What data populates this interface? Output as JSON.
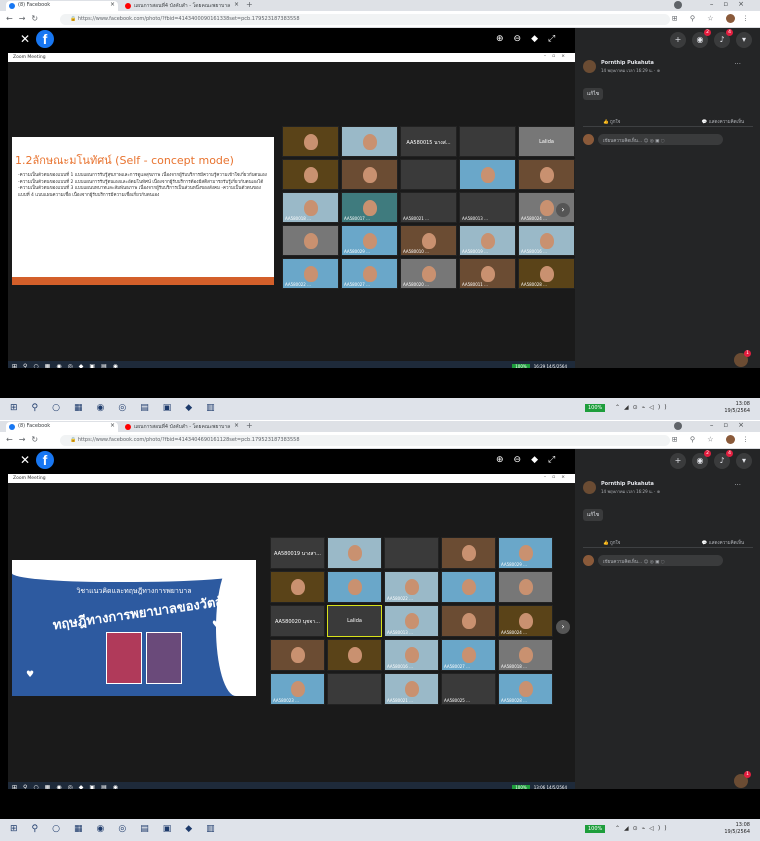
{
  "screens": [
    {
      "tabs": [
        {
          "label": "(8) Facebook"
        },
        {
          "label": "แผนการสอนที่4 บังคับสำ - โดยคณะพยาบาล"
        }
      ],
      "url": "https://www.facebook.com/photo/?fbid=4143400090161338set=pcb.179523187383558",
      "zoom_title": "Zoom Meeting",
      "slide": {
        "title": "1.2ลักษณะมโนทัศน์ (Self - concept mode)",
        "body": "-ความเป็นตัวตนของแบบที่ 1 แบบแผนการรับรู้สุขภาพและการดูแลสุขภาพ เนื่องจากผู้รับบริการมีความรู้ความเข้าใจเกี่ยวกับตนเอง -ความเป็นตัวตนของแบบที่ 2 แบบแผนการรับรู้ตนเองและอัตมโนทัศน์ เนื่องจากผู้รับบริการต้องมีสติสามารถรับรู้เกี่ยวกับตนเองได้ -ความเป็นตัวตนของแบบที่ 3 แบบแผนบทบาทและสัมพันธภาพ เนื่องจากผู้รับบริการเป็นส่วนหนึ่งของสังคม -ความเป็นตัวตนของแบบที่ 4 แบบแผนความเชื่อ เนื่องจากผู้รับบริการมีความเชื่อเกี่ยวกับตนเอง"
      },
      "tiles": [
        {
          "label": "",
          "name": ""
        },
        {
          "label": "",
          "name": ""
        },
        {
          "label": "AA580015 นางส่...",
          "name": "AA580015 นางส่..."
        },
        {
          "label": "",
          "name": ""
        },
        {
          "label": "Lalida",
          "name": "Lalida"
        },
        {
          "label": "",
          "name": ""
        },
        {
          "label": "",
          "name": ""
        },
        {
          "label": "",
          "name": ""
        },
        {
          "label": "",
          "name": ""
        },
        {
          "label": "",
          "name": ""
        },
        {
          "label": "AA580018 ...",
          "name": ""
        },
        {
          "label": "AA580017 ...",
          "name": ""
        },
        {
          "label": "AA580021 ...",
          "name": ""
        },
        {
          "label": "AA580013 ...",
          "name": ""
        },
        {
          "label": "AA580024 ...",
          "name": ""
        },
        {
          "label": "",
          "name": ""
        },
        {
          "label": "AA580029 ...",
          "name": ""
        },
        {
          "label": "AA580010 ...",
          "name": ""
        },
        {
          "label": "AA580019 ...",
          "name": ""
        },
        {
          "label": "AA580016 ...",
          "name": ""
        },
        {
          "label": "AA580022 ...",
          "name": ""
        },
        {
          "label": "AA580027 ...",
          "name": ""
        },
        {
          "label": "AA580020 ...",
          "name": ""
        },
        {
          "label": "AA580011 ...",
          "name": ""
        },
        {
          "label": "AA580028 ...",
          "name": ""
        }
      ],
      "inner_clock": "16:29 14/5/2564",
      "outer_clock": {
        "time": "13:08",
        "date": "19/5/2564"
      },
      "battery": "100%"
    },
    {
      "tabs": [
        {
          "label": "(8) Facebook"
        },
        {
          "label": "แผนการสอนที่4 บังคับสำ - โดยคณะพยาบาล"
        }
      ],
      "url": "https://www.facebook.com/photo/?fbid=4143404690161128set=pcb.179523187383558",
      "zoom_title": "Zoom Meeting",
      "slide": {
        "subtitle": "วิชาแนวคิดและทฤษฎีทางการพยาบาล",
        "title": "ทฤษฎีทางการพยาบาลของวัตสัน"
      },
      "tiles": [
        {
          "label": "AA580019 นางสา...",
          "name": "AA580019 นางสา..."
        },
        {
          "label": "",
          "name": ""
        },
        {
          "label": "",
          "name": ""
        },
        {
          "label": "",
          "name": ""
        },
        {
          "label": "AA580029 ...",
          "name": ""
        },
        {
          "label": "",
          "name": ""
        },
        {
          "label": "",
          "name": ""
        },
        {
          "label": "AA580022 ...",
          "name": ""
        },
        {
          "label": "",
          "name": ""
        },
        {
          "label": "",
          "name": ""
        },
        {
          "label": "AA580020 นุชจา...",
          "name": "AA580020 นุชจา..."
        },
        {
          "label": "Lalida",
          "name": "Lalida"
        },
        {
          "label": "AA580013 ...",
          "name": ""
        },
        {
          "label": "",
          "name": ""
        },
        {
          "label": "AA580024 ...",
          "name": ""
        },
        {
          "label": "",
          "name": ""
        },
        {
          "label": "",
          "name": ""
        },
        {
          "label": "AA580016 ...",
          "name": ""
        },
        {
          "label": "AA580027 ...",
          "name": ""
        },
        {
          "label": "AA580018 ...",
          "name": ""
        },
        {
          "label": "AA580023 ...",
          "name": ""
        },
        {
          "label": "",
          "name": ""
        },
        {
          "label": "AA580021 ...",
          "name": ""
        },
        {
          "label": "AA580025 ...",
          "name": ""
        },
        {
          "label": "AA580028 ...",
          "name": ""
        }
      ],
      "inner_clock": "13:06 14/5/2564",
      "outer_clock": {
        "time": "13:08",
        "date": "19/5/2564"
      },
      "battery": "100%"
    }
  ],
  "post": {
    "author": "Pornthip Pukahuta",
    "time": "14 พฤษภาคม เวลา 16:29 น. · ",
    "button": "แก้ไข",
    "like": "ถูกใจ",
    "comment": "แสดงความคิดเห็น",
    "comment_placeholder": "เขียนความคิดเห็น..."
  },
  "badges": {
    "messenger": "2",
    "notifications": "4",
    "chat": "1"
  },
  "colors": {
    "facebook_blue": "#1877f2",
    "slide_orange": "#e8732f",
    "slide_blue": "#2d5aa0",
    "badge_red": "#e41e3f"
  }
}
